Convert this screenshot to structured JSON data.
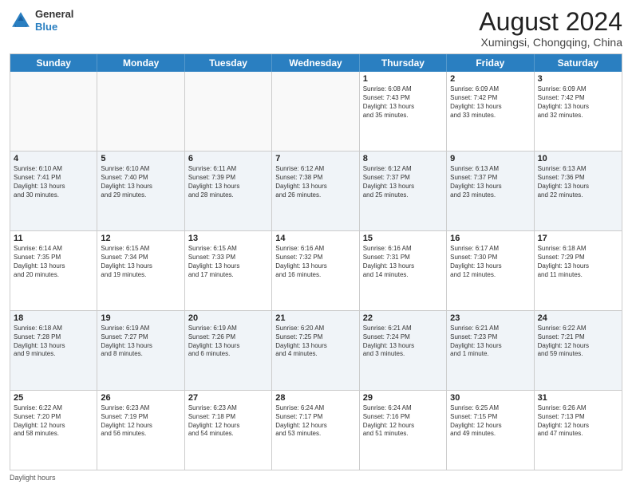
{
  "header": {
    "logo_line1": "General",
    "logo_line2": "Blue",
    "month_year": "August 2024",
    "location": "Xumingsi, Chongqing, China"
  },
  "days_of_week": [
    "Sunday",
    "Monday",
    "Tuesday",
    "Wednesday",
    "Thursday",
    "Friday",
    "Saturday"
  ],
  "footer": {
    "label": "Daylight hours"
  },
  "weeks": [
    [
      {
        "day": "",
        "info": ""
      },
      {
        "day": "",
        "info": ""
      },
      {
        "day": "",
        "info": ""
      },
      {
        "day": "",
        "info": ""
      },
      {
        "day": "1",
        "info": "Sunrise: 6:08 AM\nSunset: 7:43 PM\nDaylight: 13 hours\nand 35 minutes."
      },
      {
        "day": "2",
        "info": "Sunrise: 6:09 AM\nSunset: 7:42 PM\nDaylight: 13 hours\nand 33 minutes."
      },
      {
        "day": "3",
        "info": "Sunrise: 6:09 AM\nSunset: 7:42 PM\nDaylight: 13 hours\nand 32 minutes."
      }
    ],
    [
      {
        "day": "4",
        "info": "Sunrise: 6:10 AM\nSunset: 7:41 PM\nDaylight: 13 hours\nand 30 minutes."
      },
      {
        "day": "5",
        "info": "Sunrise: 6:10 AM\nSunset: 7:40 PM\nDaylight: 13 hours\nand 29 minutes."
      },
      {
        "day": "6",
        "info": "Sunrise: 6:11 AM\nSunset: 7:39 PM\nDaylight: 13 hours\nand 28 minutes."
      },
      {
        "day": "7",
        "info": "Sunrise: 6:12 AM\nSunset: 7:38 PM\nDaylight: 13 hours\nand 26 minutes."
      },
      {
        "day": "8",
        "info": "Sunrise: 6:12 AM\nSunset: 7:37 PM\nDaylight: 13 hours\nand 25 minutes."
      },
      {
        "day": "9",
        "info": "Sunrise: 6:13 AM\nSunset: 7:37 PM\nDaylight: 13 hours\nand 23 minutes."
      },
      {
        "day": "10",
        "info": "Sunrise: 6:13 AM\nSunset: 7:36 PM\nDaylight: 13 hours\nand 22 minutes."
      }
    ],
    [
      {
        "day": "11",
        "info": "Sunrise: 6:14 AM\nSunset: 7:35 PM\nDaylight: 13 hours\nand 20 minutes."
      },
      {
        "day": "12",
        "info": "Sunrise: 6:15 AM\nSunset: 7:34 PM\nDaylight: 13 hours\nand 19 minutes."
      },
      {
        "day": "13",
        "info": "Sunrise: 6:15 AM\nSunset: 7:33 PM\nDaylight: 13 hours\nand 17 minutes."
      },
      {
        "day": "14",
        "info": "Sunrise: 6:16 AM\nSunset: 7:32 PM\nDaylight: 13 hours\nand 16 minutes."
      },
      {
        "day": "15",
        "info": "Sunrise: 6:16 AM\nSunset: 7:31 PM\nDaylight: 13 hours\nand 14 minutes."
      },
      {
        "day": "16",
        "info": "Sunrise: 6:17 AM\nSunset: 7:30 PM\nDaylight: 13 hours\nand 12 minutes."
      },
      {
        "day": "17",
        "info": "Sunrise: 6:18 AM\nSunset: 7:29 PM\nDaylight: 13 hours\nand 11 minutes."
      }
    ],
    [
      {
        "day": "18",
        "info": "Sunrise: 6:18 AM\nSunset: 7:28 PM\nDaylight: 13 hours\nand 9 minutes."
      },
      {
        "day": "19",
        "info": "Sunrise: 6:19 AM\nSunset: 7:27 PM\nDaylight: 13 hours\nand 8 minutes."
      },
      {
        "day": "20",
        "info": "Sunrise: 6:19 AM\nSunset: 7:26 PM\nDaylight: 13 hours\nand 6 minutes."
      },
      {
        "day": "21",
        "info": "Sunrise: 6:20 AM\nSunset: 7:25 PM\nDaylight: 13 hours\nand 4 minutes."
      },
      {
        "day": "22",
        "info": "Sunrise: 6:21 AM\nSunset: 7:24 PM\nDaylight: 13 hours\nand 3 minutes."
      },
      {
        "day": "23",
        "info": "Sunrise: 6:21 AM\nSunset: 7:23 PM\nDaylight: 13 hours\nand 1 minute."
      },
      {
        "day": "24",
        "info": "Sunrise: 6:22 AM\nSunset: 7:21 PM\nDaylight: 12 hours\nand 59 minutes."
      }
    ],
    [
      {
        "day": "25",
        "info": "Sunrise: 6:22 AM\nSunset: 7:20 PM\nDaylight: 12 hours\nand 58 minutes."
      },
      {
        "day": "26",
        "info": "Sunrise: 6:23 AM\nSunset: 7:19 PM\nDaylight: 12 hours\nand 56 minutes."
      },
      {
        "day": "27",
        "info": "Sunrise: 6:23 AM\nSunset: 7:18 PM\nDaylight: 12 hours\nand 54 minutes."
      },
      {
        "day": "28",
        "info": "Sunrise: 6:24 AM\nSunset: 7:17 PM\nDaylight: 12 hours\nand 53 minutes."
      },
      {
        "day": "29",
        "info": "Sunrise: 6:24 AM\nSunset: 7:16 PM\nDaylight: 12 hours\nand 51 minutes."
      },
      {
        "day": "30",
        "info": "Sunrise: 6:25 AM\nSunset: 7:15 PM\nDaylight: 12 hours\nand 49 minutes."
      },
      {
        "day": "31",
        "info": "Sunrise: 6:26 AM\nSunset: 7:13 PM\nDaylight: 12 hours\nand 47 minutes."
      }
    ]
  ]
}
